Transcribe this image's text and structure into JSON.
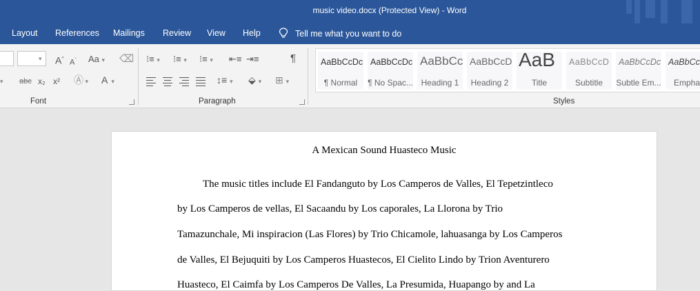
{
  "window": {
    "title": "music video.docx (Protected View)  -  Word"
  },
  "menu": {
    "items": [
      "Layout",
      "References",
      "Mailings",
      "Review",
      "View",
      "Help"
    ],
    "tell_me": "Tell me what you want to do"
  },
  "ribbon": {
    "groups": {
      "font": "Font",
      "paragraph": "Paragraph",
      "styles": "Styles"
    },
    "font_controls": {
      "change_case": "Aa",
      "grow": "A",
      "shrink": "A",
      "strike": "abc",
      "sub": "x₂",
      "sup": "x²",
      "font_color": "A"
    },
    "styles": [
      {
        "preview": "AaBbCcDc",
        "name": "¶ Normal"
      },
      {
        "preview": "AaBbCcDc",
        "name": "¶ No Spac..."
      },
      {
        "preview": "AaBbCc",
        "name": "Heading 1"
      },
      {
        "preview": "AaBbCcD",
        "name": "Heading 2"
      },
      {
        "preview": "AaB",
        "name": "Title"
      },
      {
        "preview": "AaBbCcD",
        "name": "Subtitle"
      },
      {
        "preview": "AaBbCcDc",
        "name": "Subtle Em..."
      },
      {
        "preview": "AaBbCcDc",
        "name": "Emphas"
      }
    ]
  },
  "document": {
    "title": "A Mexican Sound Huasteco Music",
    "lines": [
      "The music titles include El Fandanguto by Los Camperos de Valles, El Tepetzintleco",
      "by Los Camperos de vellas, El Sacaandu by Los caporales, La Llorona by Trio",
      "Tamazunchale, Mi inspiracion (Las Flores) by Trio Chicamole, lahuasanga by Los Camperos",
      "de Valles, El Bejuquiti by Los Camperos Huastecos, El Cielito Lindo by Trion Aventurero",
      "Huasteco, El Caimfa by Los Camperos De Valles, La Presumida, Huapango by and La"
    ]
  },
  "colors": {
    "accent": "#2b579a",
    "ribbon_bg": "#f3f3f3",
    "canvas_bg": "#e6e6e6"
  }
}
